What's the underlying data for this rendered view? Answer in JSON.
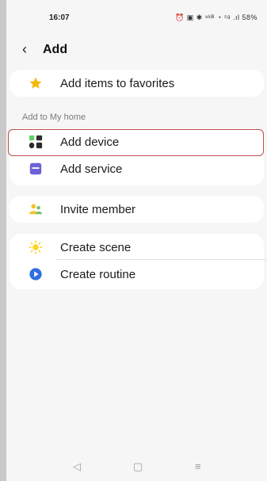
{
  "status_bar": {
    "time": "16:07",
    "icons_text": "⏰ ▣ ✱ ⁹ᵏᴮ ◔ ⁵ᵍ .ıl 58%"
  },
  "header": {
    "back_symbol": "‹",
    "title": "Add"
  },
  "favorites": {
    "label": "Add items to favorites",
    "icon": "star-icon"
  },
  "section": {
    "label": "Add to My home"
  },
  "home_items": [
    {
      "label": "Add device",
      "icon": "device-icon"
    },
    {
      "label": "Add service",
      "icon": "service-icon"
    }
  ],
  "invite": {
    "label": "Invite member",
    "icon": "member-icon"
  },
  "automation": [
    {
      "label": "Create scene",
      "icon": "sun-icon"
    },
    {
      "label": "Create routine",
      "icon": "play-icon"
    }
  ],
  "nav": {
    "back": "◁",
    "home": "▢",
    "recents": "≡"
  },
  "colors": {
    "background": "#f6f6f6",
    "card": "#ffffff",
    "star": "#f5b700",
    "device_green": "#5fcf6a",
    "device_dark": "#2b2b2b",
    "service_purple": "#6b62d6",
    "member_yellow": "#f2c230",
    "member_green": "#77c26a",
    "sun": "#ffd21c",
    "play_blue": "#2f6fe0",
    "highlight_border": "#c0504d"
  }
}
